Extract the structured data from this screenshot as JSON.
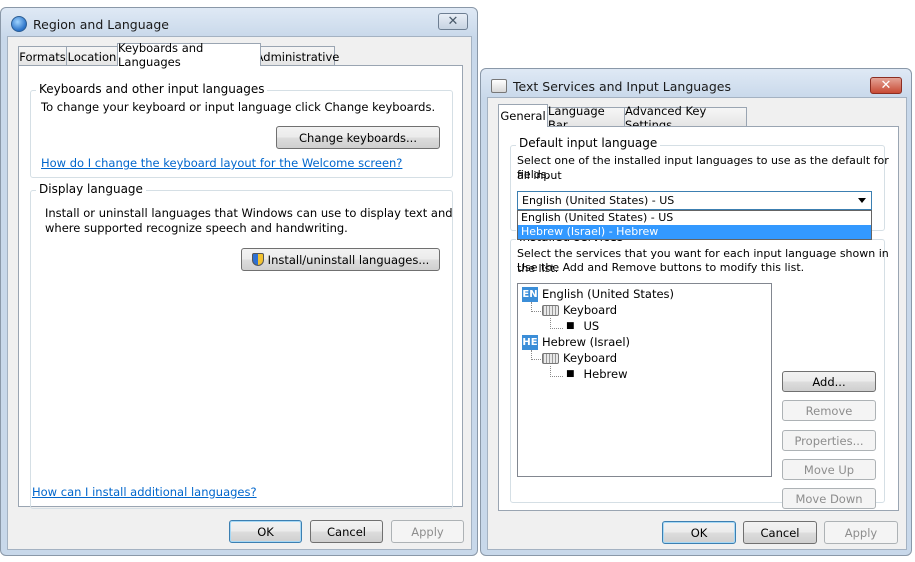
{
  "region": {
    "title": "Region and Language",
    "tabs": [
      "Formats",
      "Location",
      "Keyboards and Languages",
      "Administrative"
    ],
    "keyboards_group": {
      "title": "Keyboards and other input languages",
      "text": "To change your keyboard or input language click Change keyboards.",
      "button": "Change keyboards...",
      "link": "How do I change the keyboard layout for the Welcome screen?"
    },
    "display_group": {
      "title": "Display language",
      "text_line1": "Install or uninstall languages that Windows can use to display text and",
      "text_line2": "where supported recognize speech and handwriting.",
      "button": "Install/uninstall languages..."
    },
    "bottom_link": "How can I install additional languages?",
    "buttons": {
      "ok": "OK",
      "cancel": "Cancel",
      "apply": "Apply"
    }
  },
  "text_services": {
    "title": "Text Services and Input Languages",
    "tabs": [
      "General",
      "Language Bar",
      "Advanced Key Settings"
    ],
    "default_group": {
      "title": "Default input language",
      "text_line1": "Select one of the installed input languages to use as the default for all input",
      "text_line2": "fields.",
      "selected": "English (United States) - US",
      "options": [
        "English (United States) - US",
        "Hebrew (Israel) - Hebrew"
      ],
      "highlighted_option": 1
    },
    "installed_group": {
      "title": "Installed services",
      "text_line1": "Select the services that you want for each input language shown in the list.",
      "text_line2": "Use the Add and Remove buttons to modify this list."
    },
    "tree": [
      {
        "badge": "EN",
        "language": "English (United States)",
        "category": "Keyboard",
        "layout": "US"
      },
      {
        "badge": "HE",
        "language": "Hebrew (Israel)",
        "category": "Keyboard",
        "layout": "Hebrew"
      }
    ],
    "side_buttons": {
      "add": "Add...",
      "remove": "Remove",
      "properties": "Properties...",
      "move_up": "Move Up",
      "move_down": "Move Down"
    },
    "buttons": {
      "ok": "OK",
      "cancel": "Cancel",
      "apply": "Apply"
    }
  },
  "colors": {
    "link": "#0066cc",
    "selection": "#3399ff",
    "badge": "#3b8ed8",
    "close_button": "#c75050"
  }
}
